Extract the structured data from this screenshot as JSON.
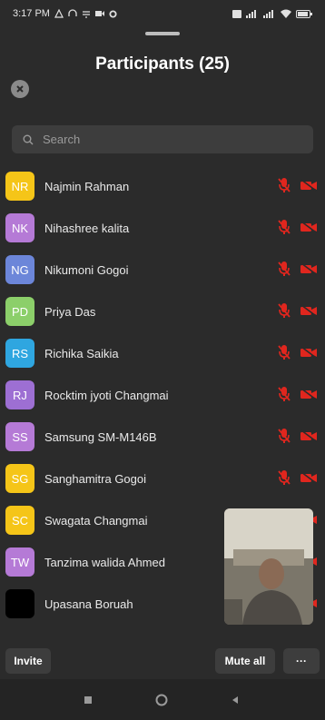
{
  "status_bar": {
    "time": "3:17 PM",
    "left_icons": [
      "notification-icon",
      "headset-icon",
      "download-icon",
      "video-icon",
      "settings-icon"
    ],
    "right_icons": [
      "vibrate-icon",
      "signal-icon",
      "signal-icon",
      "wifi-icon",
      "battery-icon"
    ]
  },
  "header": {
    "title": "Participants (25)"
  },
  "search": {
    "placeholder": "Search"
  },
  "participants": [
    {
      "initials": "NR",
      "name": "Najmin Rahman",
      "color": "#f5c518",
      "mic": "muted",
      "video": "off"
    },
    {
      "initials": "NK",
      "name": "Nihashree kalita",
      "color": "#b57ad6",
      "mic": "muted",
      "video": "off"
    },
    {
      "initials": "NG",
      "name": "Nikumoni Gogoi",
      "color": "#6c86d9",
      "mic": "muted",
      "video": "off"
    },
    {
      "initials": "PD",
      "name": "Priya Das",
      "color": "#8ccf6a",
      "mic": "muted",
      "video": "off"
    },
    {
      "initials": "RS",
      "name": "Richika Saikia",
      "color": "#2fa6e0",
      "mic": "muted",
      "video": "off"
    },
    {
      "initials": "RJ",
      "name": "Rocktim jyoti Changmai",
      "color": "#9d6fd3",
      "mic": "muted",
      "video": "off"
    },
    {
      "initials": "SS",
      "name": "Samsung SM-M146B",
      "color": "#b57ad6",
      "mic": "muted",
      "video": "off"
    },
    {
      "initials": "SG",
      "name": "Sanghamitra Gogoi",
      "color": "#f5c518",
      "mic": "muted",
      "video": "off"
    },
    {
      "initials": "SC",
      "name": "Swagata Changmai",
      "color": "#f5c518",
      "mic": "muted",
      "video": "off"
    },
    {
      "initials": "TW",
      "name": "Tanzima walida Ahmed",
      "color": "#b57ad6",
      "mic": "muted",
      "video": "off"
    },
    {
      "initials": "",
      "name": "Upasana Boruah",
      "color": "#000000",
      "mic": "muted",
      "video": "off"
    }
  ],
  "footer": {
    "invite_label": "Invite",
    "mute_all_label": "Mute all",
    "more_label": "···"
  },
  "colors": {
    "background": "#2b2b2b",
    "muted_red": "#e0261e"
  }
}
